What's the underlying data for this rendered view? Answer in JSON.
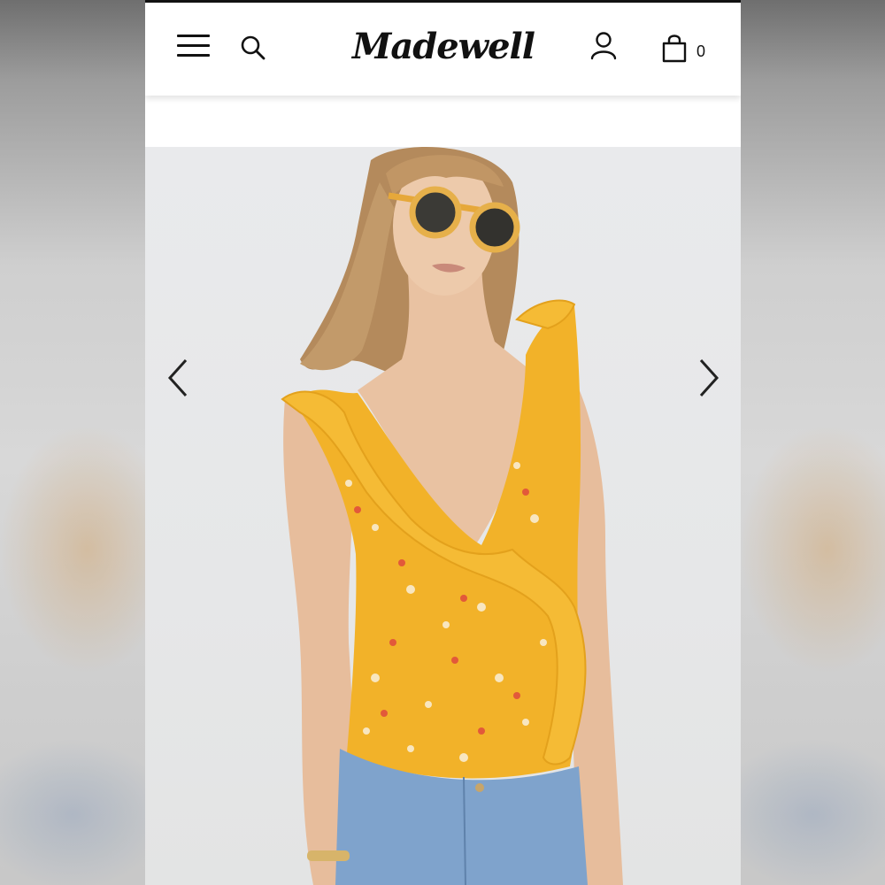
{
  "header": {
    "brand_name": "Madewell",
    "bag_count": "0",
    "icons": [
      "menu-icon",
      "search-icon",
      "account-icon",
      "shopping-bag-icon"
    ]
  },
  "gallery": {
    "controls": [
      "previous-arrow-icon",
      "next-arrow-icon"
    ],
    "colors": {
      "top": "#f2b229",
      "denim": "#7fa3cc",
      "backdrop": "#e8e9ea"
    }
  }
}
